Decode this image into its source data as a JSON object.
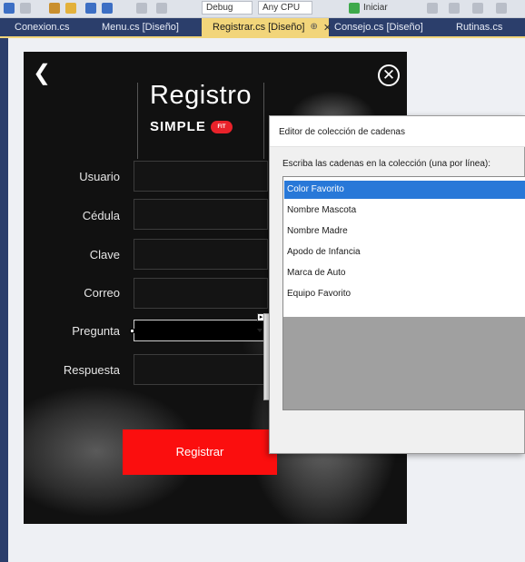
{
  "toolbar": {
    "config_combo": "Debug",
    "platform_combo": "Any CPU",
    "run_label": "Iniciar"
  },
  "tabs": [
    {
      "label": "Conexion.cs"
    },
    {
      "label": "Menu.cs [Diseño]"
    },
    {
      "label": "Registrar.cs [Diseño]",
      "active": true,
      "pin": "⊕",
      "close": "✕"
    },
    {
      "label": "Consejo.cs [Diseño]"
    },
    {
      "label": "Rutinas.cs"
    }
  ],
  "form": {
    "back_glyph": "❮",
    "close_glyph": "✕",
    "logo_title": "Registro",
    "logo_subtitle": "SIMPLE",
    "logo_badge": "FIT",
    "fields": [
      {
        "label": "Usuario"
      },
      {
        "label": "Cédula"
      },
      {
        "label": "Clave"
      },
      {
        "label": "Correo"
      },
      {
        "label": "Pregunta"
      },
      {
        "label": "Respuesta"
      }
    ],
    "register_button": "Registrar"
  },
  "dialog": {
    "title": "Editor de colección de cadenas",
    "instructions": "Escriba las cadenas en la colección (una por línea):",
    "items": [
      {
        "text": "Color Favorito",
        "selected": true
      },
      {
        "text": "Nombre  Mascota"
      },
      {
        "text": "Nombre  Madre"
      },
      {
        "text": "Apodo de Infancia"
      },
      {
        "text": "Marca de Auto"
      },
      {
        "text": "Equipo Favorito"
      }
    ]
  },
  "colors": {
    "tab_strip": "#2b3e6b",
    "active_tab": "#f2d57a",
    "form_background": "#111111",
    "register_button": "#fb0e0e",
    "selection": "#2878d8"
  }
}
